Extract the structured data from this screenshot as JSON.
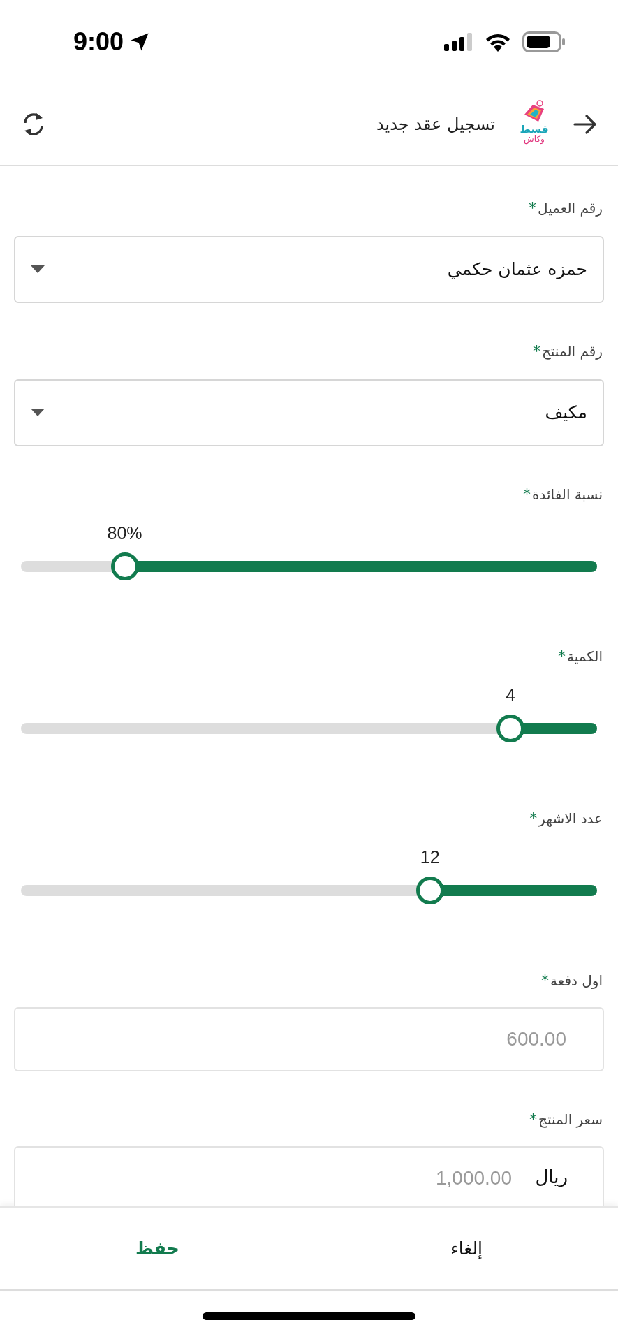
{
  "status_bar": {
    "time": "9:00"
  },
  "header": {
    "title": "تسجيل عقد جديد",
    "logo": {
      "line_1": "قسط",
      "line_2": "وكاش"
    }
  },
  "fields": [
    {
      "kind": "select",
      "label": "رقم العميل",
      "asterisk": "*",
      "value": "حمزه عثمان حكمي"
    },
    {
      "kind": "select",
      "label": "رقم المنتج",
      "asterisk": "*",
      "value": "مكيف"
    },
    {
      "kind": "slider",
      "label": "نسبة الفائدة",
      "asterisk": "*",
      "reading": "80%",
      "level": 0.82
    },
    {
      "kind": "slider",
      "label": "الكمية",
      "asterisk": "*",
      "reading": "4",
      "level": 0.15
    },
    {
      "kind": "slider",
      "label": "عدد الاشهر",
      "asterisk": "*",
      "reading": "12",
      "level": 0.29
    },
    {
      "kind": "input",
      "label": "اول دفعة",
      "asterisk": "*",
      "placeholder": "600.00"
    },
    {
      "kind": "input",
      "label": "سعر المنتج",
      "asterisk": "*",
      "prefix": "ريال",
      "placeholder": "1,000.00"
    }
  ],
  "footer": {
    "buttons": [
      {
        "label": "إلغاء",
        "kind": "cancel"
      },
      {
        "label": "حفظ",
        "kind": "primary"
      }
    ]
  }
}
